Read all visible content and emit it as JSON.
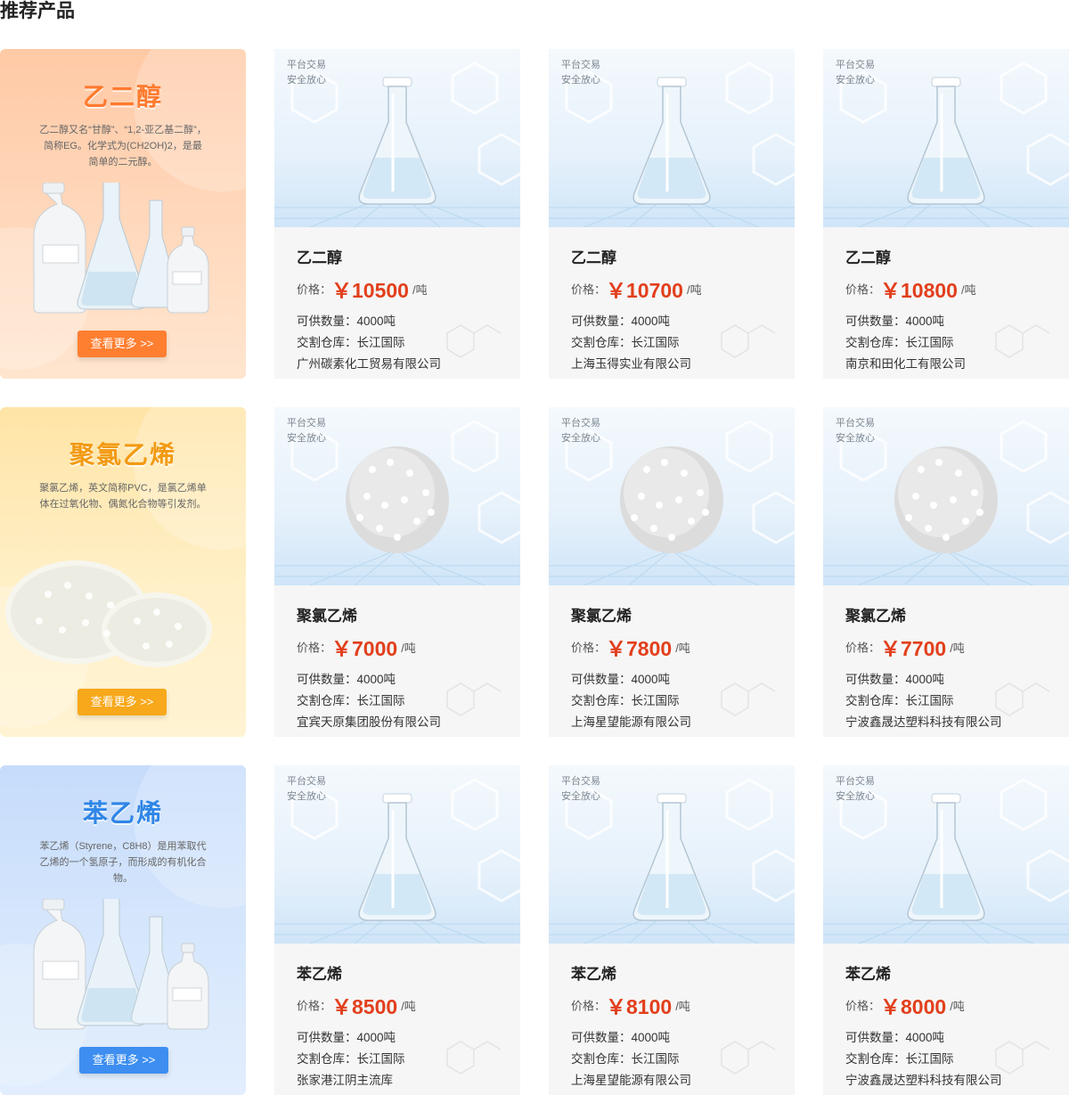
{
  "section": {
    "title": "推荐产品"
  },
  "labels": {
    "price_prefix": "价格：",
    "qty_prefix": "可供数量：",
    "warehouse_prefix": "交割仓库："
  },
  "categories": [
    {
      "name": "乙二醇",
      "theme": "orange",
      "accent": "#ff7f31",
      "description": "乙二醇又名“甘醇”、“1,2-亚乙基二醇”，简称EG。化学式为(CH2OH)2，是最简单的二元醇。",
      "button": "查看更多 >>",
      "products": [
        {
          "badge_line1": "平台交易",
          "badge_line2": "安全放心",
          "name": "乙二醇",
          "price": "￥10500",
          "unit": "/吨",
          "quantity": "4000吨",
          "warehouse": "长江国际",
          "company": "广州碳素化工贸易有限公司"
        },
        {
          "badge_line1": "平台交易",
          "badge_line2": "安全放心",
          "name": "乙二醇",
          "price": "￥10700",
          "unit": "/吨",
          "quantity": "4000吨",
          "warehouse": "长江国际",
          "company": "上海玉得实业有限公司"
        },
        {
          "badge_line1": "平台交易",
          "badge_line2": "安全放心",
          "name": "乙二醇",
          "price": "￥10800",
          "unit": "/吨",
          "quantity": "4000吨",
          "warehouse": "长江国际",
          "company": "南京和田化工有限公司"
        }
      ]
    },
    {
      "name": "聚氯乙烯",
      "theme": "yellow",
      "accent": "#f7a81b",
      "description": "聚氯乙烯，英文简称PVC，是氯乙烯单体在过氧化物、偶氮化合物等引发剂。",
      "button": "查看更多 >>",
      "products": [
        {
          "badge_line1": "平台交易",
          "badge_line2": "安全放心",
          "name": "聚氯乙烯",
          "price": "￥7000",
          "unit": "/吨",
          "quantity": "4000吨",
          "warehouse": "长江国际",
          "company": "宜宾天原集团股份有限公司"
        },
        {
          "badge_line1": "平台交易",
          "badge_line2": "安全放心",
          "name": "聚氯乙烯",
          "price": "￥7800",
          "unit": "/吨",
          "quantity": "4000吨",
          "warehouse": "长江国际",
          "company": "上海星望能源有限公司"
        },
        {
          "badge_line1": "平台交易",
          "badge_line2": "安全放心",
          "name": "聚氯乙烯",
          "price": "￥7700",
          "unit": "/吨",
          "quantity": "4000吨",
          "warehouse": "长江国际",
          "company": "宁波鑫晟达塑料科技有限公司"
        }
      ]
    },
    {
      "name": "苯乙烯",
      "theme": "blue",
      "accent": "#3d8ef0",
      "description": "苯乙烯（Styrene，C8H8）是用苯取代乙烯的一个氢原子，而形成的有机化合物。",
      "button": "查看更多 >>",
      "products": [
        {
          "badge_line1": "平台交易",
          "badge_line2": "安全放心",
          "name": "苯乙烯",
          "price": "￥8500",
          "unit": "/吨",
          "quantity": "4000吨",
          "warehouse": "长江国际",
          "company": "张家港江阴主流库"
        },
        {
          "badge_line1": "平台交易",
          "badge_line2": "安全放心",
          "name": "苯乙烯",
          "price": "￥8100",
          "unit": "/吨",
          "quantity": "4000吨",
          "warehouse": "长江国际",
          "company": "上海星望能源有限公司"
        },
        {
          "badge_line1": "平台交易",
          "badge_line2": "安全放心",
          "name": "苯乙烯",
          "price": "￥8000",
          "unit": "/吨",
          "quantity": "4000吨",
          "warehouse": "长江国际",
          "company": "宁波鑫晟达塑料科技有限公司"
        }
      ]
    }
  ]
}
